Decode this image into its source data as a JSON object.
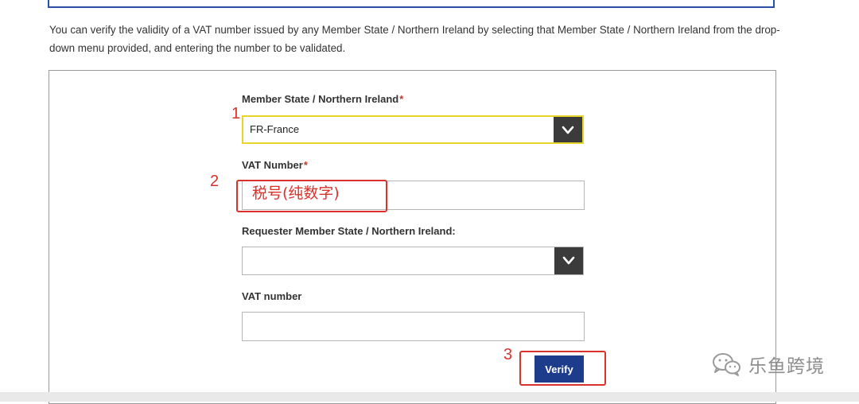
{
  "intro": {
    "text": "You can verify the validity of a VAT number issued by any Member State / Northern Ireland by selecting that Member State / Northern Ireland from the drop-down menu provided, and entering the number to be validated."
  },
  "form": {
    "member_state": {
      "label": "Member State / Northern Ireland",
      "required_mark": "*",
      "selected_value": "FR-France"
    },
    "vat_number": {
      "label": "VAT Number",
      "required_mark": "*",
      "value": ""
    },
    "requester_member_state": {
      "label": "Requester Member State / Northern Ireland:",
      "selected_value": ""
    },
    "requester_vat_number": {
      "label": "VAT number",
      "value": ""
    },
    "verify_label": "Verify"
  },
  "annotations": {
    "step1": "1",
    "step2": "2",
    "step3": "3",
    "vat_note": "税号(纯数字)",
    "color": "#d9322b"
  },
  "watermark": {
    "text": "乐鱼跨境",
    "icon": "wechat-icon"
  },
  "colors": {
    "select_highlight": "#e8d52a",
    "button": "#1e3c8c",
    "required": "#c0392b",
    "top_border": "#2a4fa5"
  }
}
